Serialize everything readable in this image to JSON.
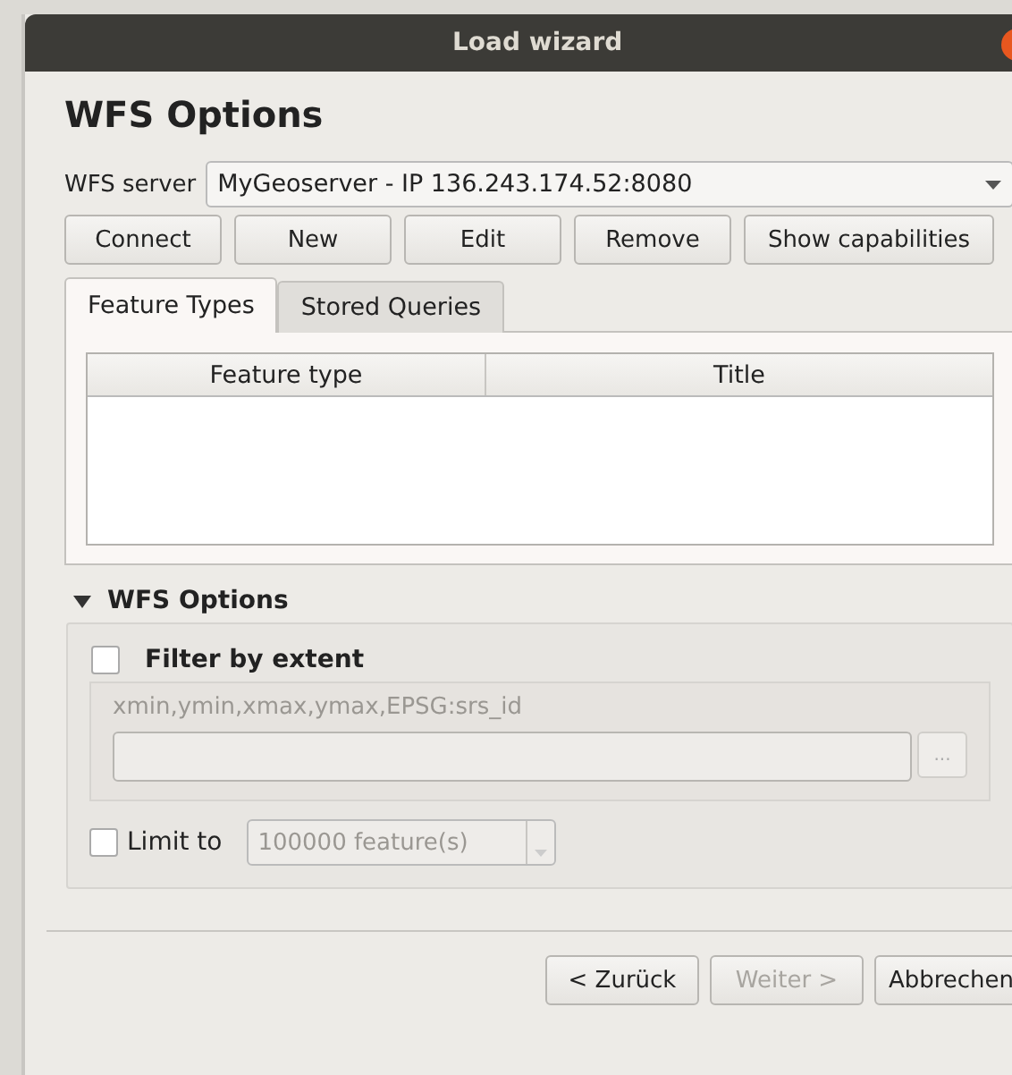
{
  "window": {
    "title": "Load wizard"
  },
  "page_title": "WFS Options",
  "server": {
    "label": "WFS server",
    "value": "MyGeoserver - IP 136.243.174.52:8080"
  },
  "server_buttons": [
    {
      "label": "Connect"
    },
    {
      "label": "New"
    },
    {
      "label": "Edit"
    },
    {
      "label": "Remove"
    },
    {
      "label": "Show capabilities"
    }
  ],
  "tabs": [
    {
      "label": "Feature Types",
      "selected": true
    },
    {
      "label": "Stored Queries",
      "selected": false
    }
  ],
  "table": {
    "columns": [
      "Feature type",
      "Title"
    ]
  },
  "options_section": {
    "title": "WFS Options",
    "expanded": true,
    "filter": {
      "label": "Filter by extent",
      "checked": false,
      "hint": "xmin,ymin,xmax,ymax,EPSG:srs_id",
      "browse": "...",
      "disabled": true
    },
    "limit": {
      "label": "Limit to",
      "checked": false,
      "value": "100000 feature(s)",
      "disabled": true
    }
  },
  "footer_buttons": [
    {
      "label": "< Zurück",
      "disabled": false
    },
    {
      "label": "Weiter >",
      "disabled": true
    },
    {
      "label": "Abbrechen",
      "disabled": false
    }
  ]
}
